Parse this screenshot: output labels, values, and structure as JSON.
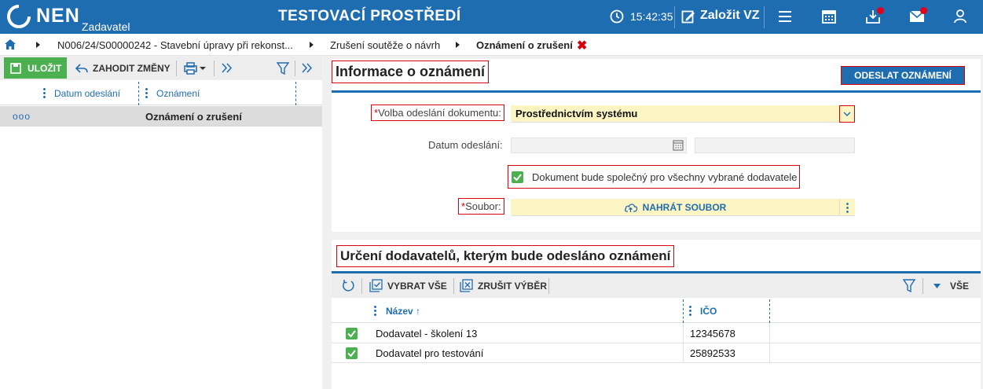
{
  "header": {
    "brand": "NEN",
    "brand_sub": "Zadavatel",
    "env_title": "TESTOVACÍ PROSTŘEDÍ",
    "clock": "15:42:35",
    "create_label": "Založit VZ",
    "icons": [
      "clock-icon",
      "edit-icon",
      "menu-icon",
      "calendar-icon",
      "inbox-icon",
      "mail-icon",
      "user-icon"
    ],
    "accent_color": "#1f6db1",
    "notification_color": "#e2001a"
  },
  "breadcrumb": {
    "items": [
      "N006/24/S00000242 - Stavební úpravy při rekonst...",
      "Zrušení soutěže o návrh",
      "Oznámení o zrušení"
    ]
  },
  "left_panel": {
    "save_label": "ULOŽIT",
    "discard_label": "ZAHODIT ZMĚNY",
    "columns": [
      "Datum odeslání",
      "Oznámení"
    ],
    "rows": [
      {
        "dots": "ooo",
        "label": "Oznámení o zrušení"
      }
    ]
  },
  "info_section": {
    "title": "Informace o oznámení",
    "send_button": "ODESLAT OZNÁMENÍ",
    "send_method_label": "Volba odeslání dokumentu:",
    "send_method_value": "Prostřednictvím systému",
    "date_label": "Datum odeslání:",
    "common_doc_label": "Dokument bude společný pro všechny vybrané dodavatele",
    "common_doc_checked": true,
    "file_label": "Soubor:",
    "upload_label": "NAHRÁT SOUBOR",
    "required_mark": "*"
  },
  "suppliers_section": {
    "title": "Určení dodavatelů, kterým bude odesláno oznámení",
    "select_all": "VYBRAT VŠE",
    "clear_selection": "ZRUŠIT VÝBĚR",
    "filter_scope": "VŠE",
    "columns": {
      "name": "Název",
      "ico": "IČO"
    },
    "rows": [
      {
        "checked": true,
        "name": "Dodavatel - školení 13",
        "ico": "12345678"
      },
      {
        "checked": true,
        "name": "Dodavatel pro testování",
        "ico": "25892533"
      }
    ]
  }
}
